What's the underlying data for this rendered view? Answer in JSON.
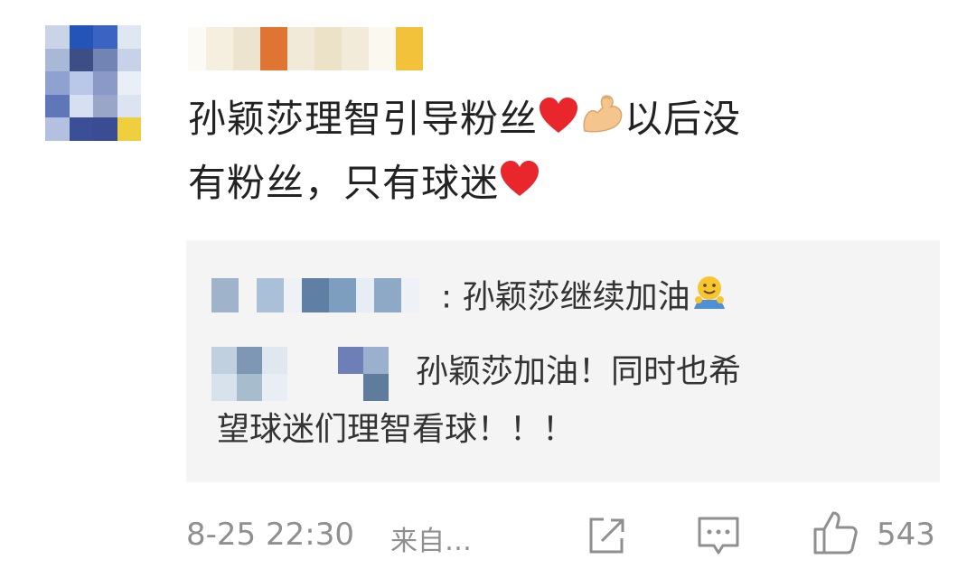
{
  "comment": {
    "text_line1": "孙颖莎理智引导粉丝",
    "text_line1_after": "以后没",
    "text_line2": "有粉丝，只有球迷",
    "emojis": [
      "heart-emoji",
      "flexed-biceps-emoji",
      "heart-emoji"
    ]
  },
  "replies": [
    {
      "separator": ":",
      "text": "孙颖莎继续加油",
      "emoji": "hugging-face-emoji"
    },
    {
      "text_line1": "孙颖莎加油！同时也希",
      "text_line2": "望球迷们理智看球！！！"
    }
  ],
  "footer": {
    "timestamp": "8-25 22:30",
    "source": "来自…",
    "like_count": "543",
    "icons": [
      "share-icon",
      "comment-icon",
      "like-icon"
    ]
  },
  "colors": {
    "heart": "#e8262c",
    "muted_text": "#8f8f8f",
    "reply_bg": "#f4f4f4"
  }
}
